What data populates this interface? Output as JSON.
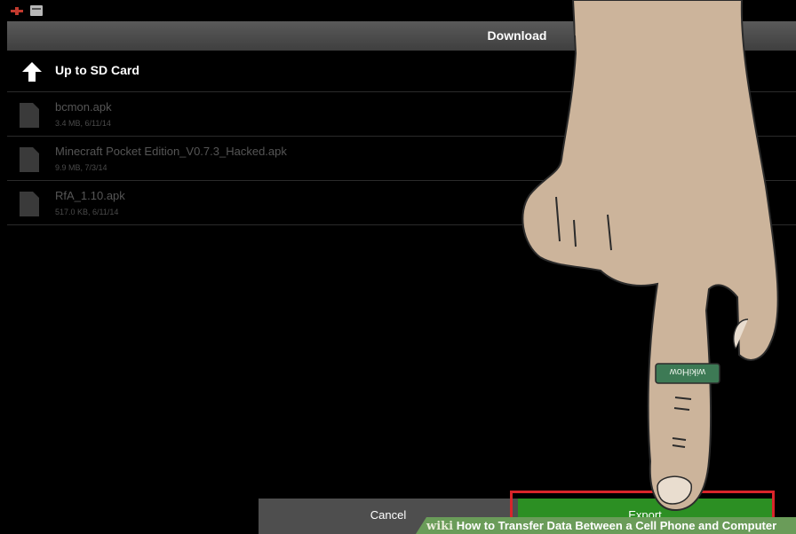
{
  "dialog": {
    "title": "Download"
  },
  "list": {
    "up": {
      "label": "Up to SD Card",
      "icon": "arrow-up-icon"
    },
    "files": [
      {
        "name": "bcmon.apk",
        "meta": "3.4 MB, 6/11/14",
        "icon": "file-icon"
      },
      {
        "name": "Minecraft Pocket Edition_V0.7.3_Hacked.apk",
        "meta": "9.9 MB, 7/3/14",
        "icon": "file-icon"
      },
      {
        "name": "RfA_1.10.apk",
        "meta": "517.0 KB, 6/11/14",
        "icon": "file-icon"
      }
    ]
  },
  "buttons": {
    "cancel": "Cancel",
    "export": "Export"
  },
  "overlay": {
    "ring_text": "wikiHow",
    "watermark_wiki": "wiki",
    "watermark_text": "How to Transfer Data Between a Cell Phone and Computer"
  },
  "colors": {
    "export_green": "#2c8f23",
    "highlight_red": "#d9252a",
    "skin": "#ccb49b"
  }
}
